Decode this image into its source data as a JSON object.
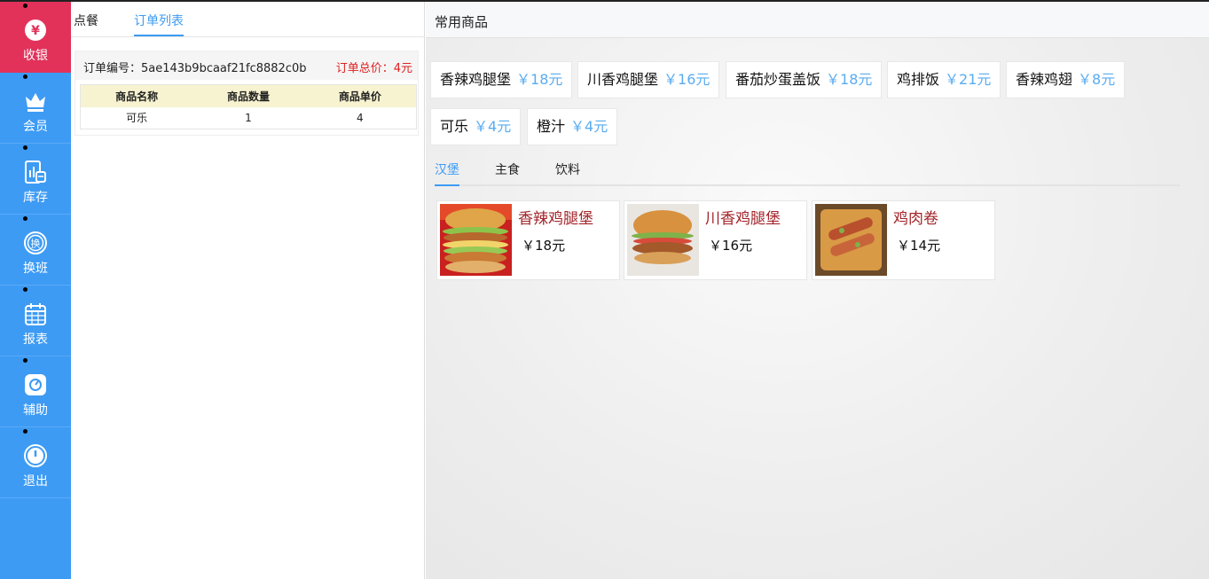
{
  "sidebar": {
    "items": [
      {
        "label": "收银",
        "icon": "yen-icon",
        "active": true
      },
      {
        "label": "会员",
        "icon": "crown-icon"
      },
      {
        "label": "库存",
        "icon": "inventory-icon"
      },
      {
        "label": "换班",
        "icon": "shift-change-icon"
      },
      {
        "label": "报表",
        "icon": "calendar-icon"
      },
      {
        "label": "辅助",
        "icon": "assist-icon"
      },
      {
        "label": "退出",
        "icon": "power-icon"
      }
    ]
  },
  "colors": {
    "sidebar": "#3d9bf4",
    "active_nav": "#e2325a",
    "accent": "#3d9bf4",
    "total": "#e02020",
    "chip_price": "#5aacf0",
    "product_name": "#a3242a"
  },
  "order_panel": {
    "tabs": [
      "点餐",
      "订单列表"
    ],
    "active_tab": "订单列表",
    "order": {
      "number_label": "订单编号：5ae143b9bcaaf21fc8882c0b",
      "total_label": "订单总价：4元",
      "columns": [
        "商品名称",
        "商品数量",
        "商品单价"
      ],
      "rows": [
        [
          "可乐",
          "1",
          "4"
        ]
      ]
    }
  },
  "goods_panel": {
    "title": "常用商品",
    "frequent": [
      {
        "name": "香辣鸡腿堡",
        "price": "￥18元"
      },
      {
        "name": "川香鸡腿堡",
        "price": "￥16元"
      },
      {
        "name": "番茄炒蛋盖饭",
        "price": "￥18元"
      },
      {
        "name": "鸡排饭",
        "price": "￥21元"
      },
      {
        "name": "香辣鸡翅",
        "price": "￥8元"
      },
      {
        "name": "可乐",
        "price": "￥4元"
      },
      {
        "name": "橙汁",
        "price": "￥4元"
      }
    ],
    "categories": [
      "汉堡",
      "主食",
      "饮料"
    ],
    "active_category": "汉堡",
    "products": [
      {
        "name": "香辣鸡腿堡",
        "price": "￥18元"
      },
      {
        "name": "川香鸡腿堡",
        "price": "￥16元"
      },
      {
        "name": "鸡肉卷",
        "price": "￥14元"
      }
    ]
  }
}
